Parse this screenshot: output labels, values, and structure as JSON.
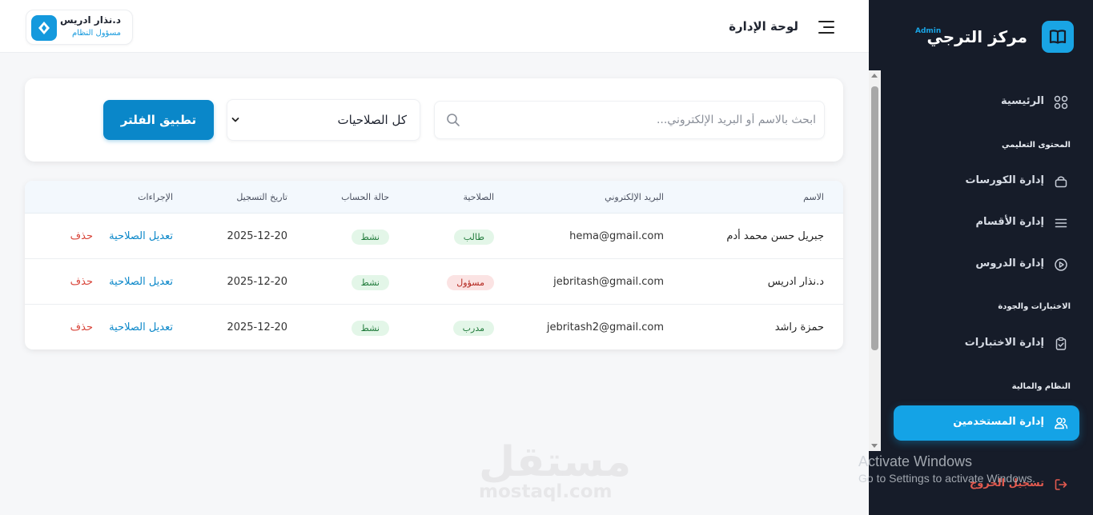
{
  "header": {
    "page_title": "لوحة الإدارة",
    "user_name": "د.نذار ادريس",
    "user_role": "مسؤول النظام"
  },
  "filter": {
    "search_placeholder": "ابحث بالاسم أو البريد الإلكتروني...",
    "role_selected": "كل الصلاحيات",
    "apply_label": "تطبيق الفلتر"
  },
  "table": {
    "columns": [
      "الاسم",
      "البريد الإلكتروني",
      "الصلاحية",
      "حالة الحساب",
      "تاريخ التسجيل",
      "الإجراءات"
    ],
    "rows": [
      {
        "name": "جبريل حسن محمد أدم",
        "email": "hema@gmail.com",
        "role": "طالب",
        "status": "نشط",
        "date": "2025-12-20",
        "edit": "تعديل الصلاحية",
        "delete": "حذف"
      },
      {
        "name": "د.نذار ادريس",
        "email": "jebritash@gmail.com",
        "role": "مسؤول",
        "status": "نشط",
        "date": "2025-12-20",
        "edit": "تعديل الصلاحية",
        "delete": "حذف"
      },
      {
        "name": "حمزة راشد",
        "email": "jebritash2@gmail.com",
        "role": "مدرب",
        "status": "نشط",
        "date": "2025-12-20",
        "edit": "تعديل الصلاحية",
        "delete": "حذف"
      }
    ]
  },
  "sidebar": {
    "brand_name": "مركز الترجي",
    "brand_tag": "Admin",
    "home": "الرئيسية",
    "section_content": "المحتوى التعليمي",
    "courses": "إدارة الكورسات",
    "departments": "إدارة الأقسام",
    "lessons": "إدارة الدروس",
    "section_exams": "الاختبارات والجودة",
    "exams": "إدارة الاختبارات",
    "section_system": "النظام والمالية",
    "users": "إدارة المستخدمين",
    "logout": "تسجيل الخروج"
  },
  "watermark": {
    "arabic": "مستقل",
    "latin": "mostaql.com"
  },
  "windows_notice": {
    "title": "Activate Windows",
    "subtitle": "Go to Settings to activate Windows."
  },
  "colors": {
    "accent": "#0a87c9",
    "sidebar_bg": "#161c29",
    "active_nav": "#14a3e6",
    "danger": "#d9473c"
  }
}
